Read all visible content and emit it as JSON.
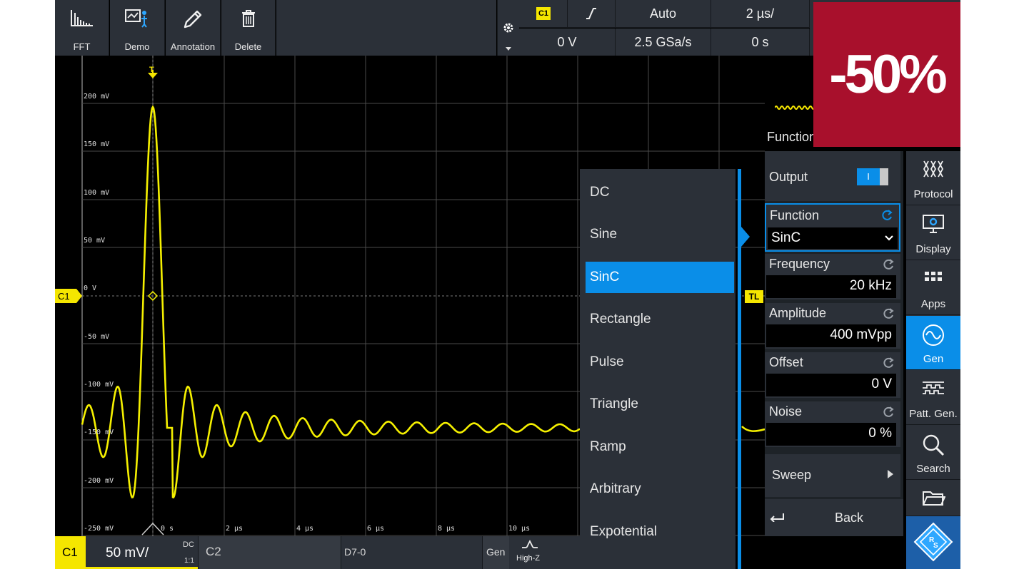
{
  "toolbar": {
    "fft_label": "FFT",
    "demo_label": "Demo",
    "annotation_label": "Annotation",
    "delete_label": "Delete"
  },
  "trigger": {
    "channel": "C1",
    "mode": "Auto",
    "timebase": "2 µs/",
    "level": "0 V",
    "sample_rate": "2.5 GSa/s",
    "position": "0 s"
  },
  "promo": {
    "text": "-50%"
  },
  "waveform": {
    "y_labels": [
      "200 mV",
      "150 mV",
      "100 mV",
      "50 mV",
      "0 V",
      "-50 mV",
      "-100 mV",
      "-150 mV",
      "-200 mV",
      "-250 mV"
    ],
    "x_labels": [
      "0 s",
      "2 µs",
      "4 µs",
      "6 µs",
      "8 µs",
      "10 µs"
    ],
    "channel_marker": "C1",
    "trigger_marker": "T",
    "trigger_level_marker": "TL"
  },
  "function_menu": {
    "items": [
      "DC",
      "Sine",
      "SinC",
      "Rectangle",
      "Pulse",
      "Triangle",
      "Ramp",
      "Arbitrary",
      "Expotential"
    ],
    "selected": "SinC"
  },
  "gen_panel": {
    "title": "Function",
    "output_label": "Output",
    "output_toggle": "I",
    "function_label": "Function",
    "function_value": "SinC",
    "frequency_label": "Frequency",
    "frequency_value": "20 kHz",
    "amplitude_label": "Amplitude",
    "amplitude_value": "400 mVpp",
    "offset_label": "Offset",
    "offset_value": "0 V",
    "noise_label": "Noise",
    "noise_value": "0 %",
    "sweep_label": "Sweep",
    "back_label": "Back"
  },
  "sidebar": {
    "items": [
      "Protocol",
      "Display",
      "Apps",
      "Gen",
      "Patt. Gen.",
      "Search"
    ],
    "active": "Gen"
  },
  "status_bar": {
    "c1_label": "C1",
    "c1_scale": "50 mV/",
    "c1_coupling": "DC",
    "c1_probe": "1:1",
    "c2_label": "C2",
    "digital_label": "D7-0",
    "gen_label": "Gen",
    "gen_impedance": "High-Z"
  },
  "colors": {
    "trace": "#f5f000",
    "accent": "#0a8ee8",
    "promo_bg": "#a8102c",
    "channel_yellow": "#f5e600"
  }
}
